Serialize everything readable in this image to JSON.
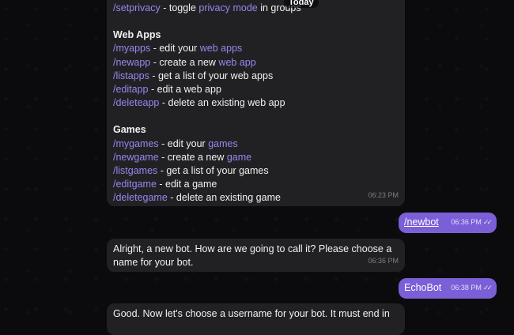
{
  "date_badge": "Today",
  "help_message": {
    "top_line": {
      "command": "/setprivacy",
      "text_a": " - toggle ",
      "link": "privacy mode",
      "text_b": " in groups"
    },
    "web_apps": {
      "title": "Web Apps",
      "lines": [
        {
          "command": "/myapps",
          "text": " - edit your ",
          "link": "web apps",
          "rest": ""
        },
        {
          "command": "/newapp",
          "text": " - create a new ",
          "link": "web app",
          "rest": ""
        },
        {
          "command": "/listapps",
          "text": " - get a list of your web apps",
          "link": "",
          "rest": ""
        },
        {
          "command": "/editapp",
          "text": " - edit a web app",
          "link": "",
          "rest": ""
        },
        {
          "command": "/deleteapp",
          "text": " - delete an existing web app",
          "link": "",
          "rest": ""
        }
      ]
    },
    "games": {
      "title": "Games",
      "lines": [
        {
          "command": "/mygames",
          "text": " - edit your ",
          "link": "games",
          "rest": ""
        },
        {
          "command": "/newgame",
          "text": " - create a new ",
          "link": "game",
          "rest": ""
        },
        {
          "command": "/listgames",
          "text": " - get a list of your games",
          "link": "",
          "rest": ""
        },
        {
          "command": "/editgame",
          "text": " - edit a game",
          "link": "",
          "rest": ""
        },
        {
          "command": "/deletegame",
          "text": " - delete an existing game",
          "link": "",
          "rest": ""
        }
      ]
    },
    "time": "06:23 PM"
  },
  "msg_newbot": {
    "text": "/newbot",
    "time": "06:36 PM"
  },
  "msg_alright": {
    "line1": "Alright, a new bot. How are we going to call it? Please choose a",
    "line2": "name for your bot.",
    "time": "06:36 PM"
  },
  "msg_echobot": {
    "text": "EchoBot",
    "time": "06:38 PM"
  },
  "msg_good": {
    "line1": "Good. Now let's choose a username for your bot. It must end in"
  },
  "colors": {
    "background": "#0b0b0d",
    "incoming_bubble": "#212124",
    "outgoing_bubble": "#7a5fd6",
    "command_link": "#9b86ee"
  },
  "icons": {
    "read_receipt": "double-check-icon"
  }
}
